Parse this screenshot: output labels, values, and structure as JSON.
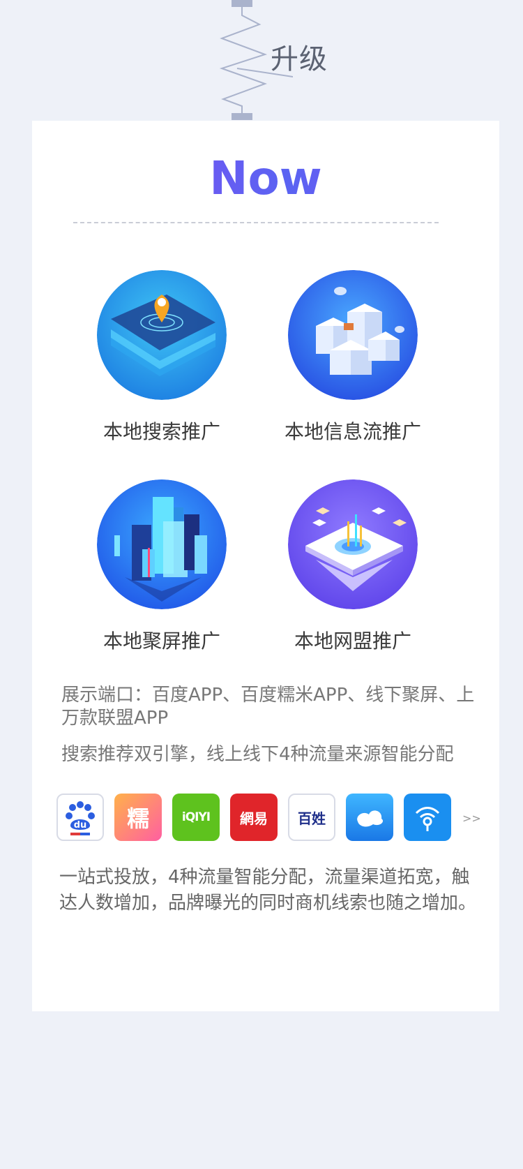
{
  "header": {
    "upgrade_title": "升级"
  },
  "card": {
    "title": "Now",
    "features": [
      {
        "label": "本地搜索推广",
        "icon": "map-pin-icon"
      },
      {
        "label": "本地信息流推广",
        "icon": "cube-city-icon"
      },
      {
        "label": "本地聚屏推广",
        "icon": "buildings-icon"
      },
      {
        "label": "本地网盟推广",
        "icon": "network-platform-icon"
      }
    ],
    "info_lines": [
      "展示端口：百度APP、百度糯米APP、线下聚屏、上万款联盟APP",
      "搜索推荐双引擎，线上线下4种流量来源智能分配"
    ],
    "apps": [
      {
        "name": "baidu-app-icon",
        "text": "du"
      },
      {
        "name": "nuomi-app-icon",
        "text": "糯"
      },
      {
        "name": "iqiyi-app-icon",
        "text": "iQIYI"
      },
      {
        "name": "netease-news-app-icon",
        "text": "網易"
      },
      {
        "name": "baixing-app-icon",
        "text": "百姓"
      },
      {
        "name": "cloud-app-icon",
        "text": ""
      },
      {
        "name": "wifi-key-app-icon",
        "text": ""
      }
    ],
    "more_arrows": ">>",
    "description": "一站式投放，4种流量智能分配，流量渠道拓宽，触达人数增加，品牌曝光的同时商机线索也随之增加。"
  },
  "colors": {
    "background": "#eef1f8",
    "title_gradient_start": "#8a4cf0",
    "title_gradient_end": "#5a63f2"
  }
}
